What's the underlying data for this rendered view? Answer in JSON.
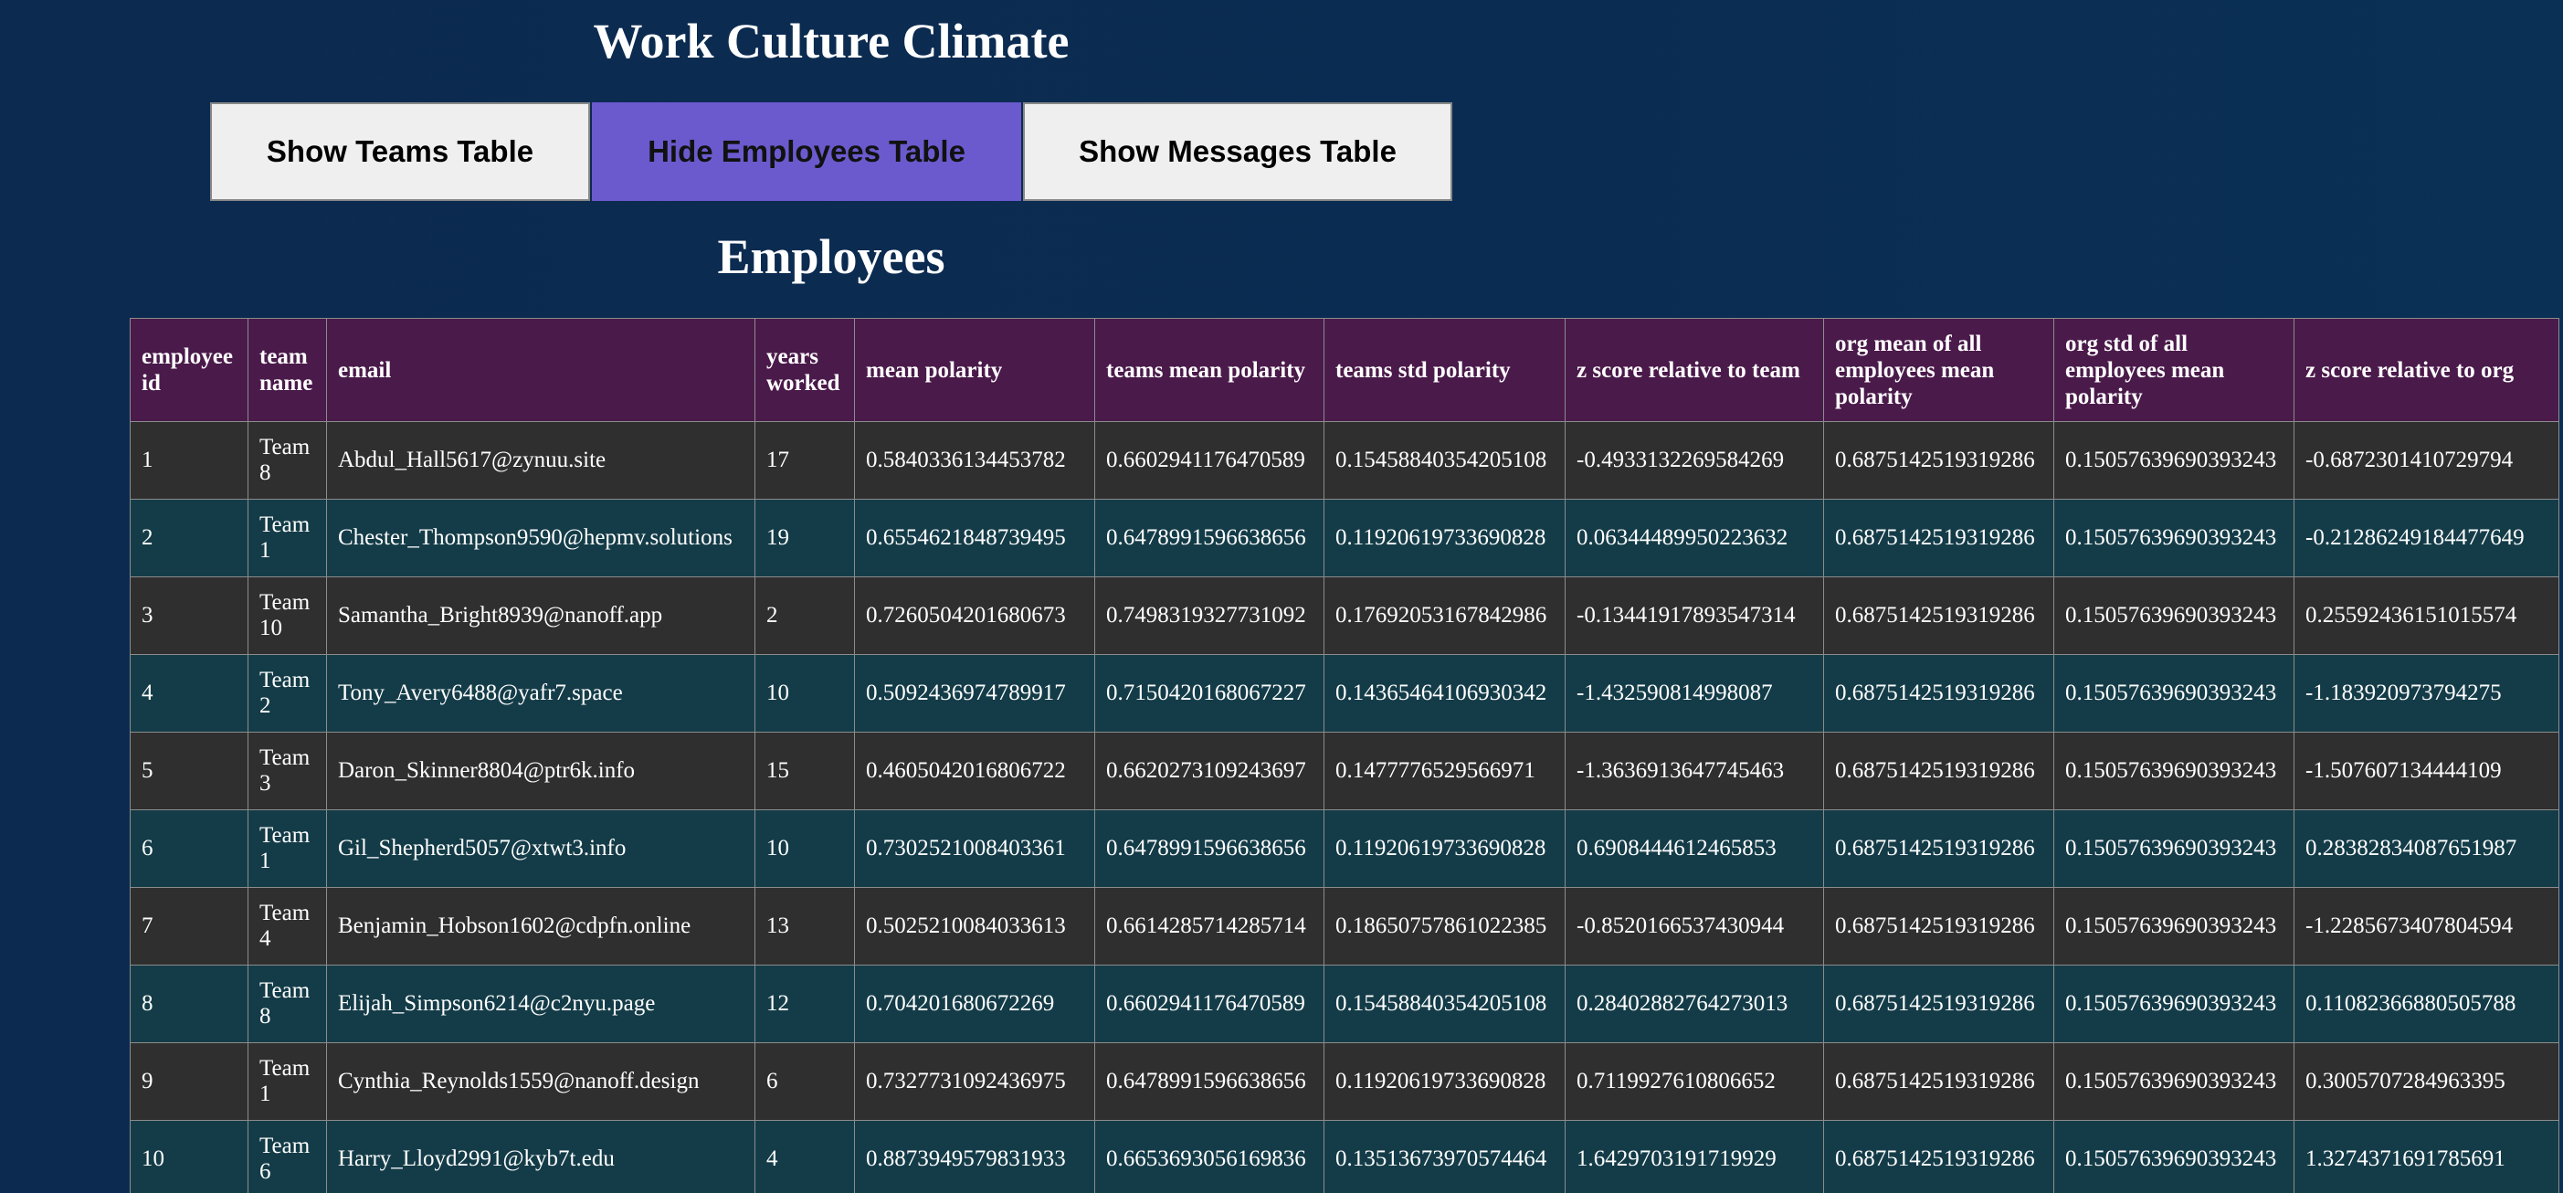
{
  "page_title": "Work Culture Climate",
  "buttons": {
    "teams": "Show Teams Table",
    "employees": "Hide Employees Table",
    "messages": "Show Messages Table"
  },
  "accent_color": "#6a5acd",
  "section_title": "Employees",
  "table": {
    "headers": [
      "employee id",
      "team name",
      "email",
      "years worked",
      "mean polarity",
      "teams mean polarity",
      "teams std polarity",
      "z score relative to team",
      "org mean of all employees mean polarity",
      "org std of all employees mean polarity",
      "z score relative to org"
    ],
    "rows": [
      [
        "1",
        "Team 8",
        "Abdul_Hall5617@zynuu.site",
        "17",
        "0.5840336134453782",
        "0.6602941176470589",
        "0.15458840354205108",
        "-0.4933132269584269",
        "0.6875142519319286",
        "0.15057639690393243",
        "-0.6872301410729794"
      ],
      [
        "2",
        "Team 1",
        "Chester_Thompson9590@hepmv.solutions",
        "19",
        "0.6554621848739495",
        "0.6478991596638656",
        "0.11920619733690828",
        "0.06344489950223632",
        "0.6875142519319286",
        "0.15057639690393243",
        "-0.21286249184477649"
      ],
      [
        "3",
        "Team 10",
        "Samantha_Bright8939@nanoff.app",
        "2",
        "0.7260504201680673",
        "0.7498319327731092",
        "0.17692053167842986",
        "-0.13441917893547314",
        "0.6875142519319286",
        "0.15057639690393243",
        "0.25592436151015574"
      ],
      [
        "4",
        "Team 2",
        "Tony_Avery6488@yafr7.space",
        "10",
        "0.5092436974789917",
        "0.7150420168067227",
        "0.14365464106930342",
        "-1.432590814998087",
        "0.6875142519319286",
        "0.15057639690393243",
        "-1.183920973794275"
      ],
      [
        "5",
        "Team 3",
        "Daron_Skinner8804@ptr6k.info",
        "15",
        "0.4605042016806722",
        "0.6620273109243697",
        "0.1477776529566971",
        "-1.3636913647745463",
        "0.6875142519319286",
        "0.15057639690393243",
        "-1.507607134444109"
      ],
      [
        "6",
        "Team 1",
        "Gil_Shepherd5057@xtwt3.info",
        "10",
        "0.7302521008403361",
        "0.6478991596638656",
        "0.11920619733690828",
        "0.6908444612465853",
        "0.6875142519319286",
        "0.15057639690393243",
        "0.28382834087651987"
      ],
      [
        "7",
        "Team 4",
        "Benjamin_Hobson1602@cdpfn.online",
        "13",
        "0.5025210084033613",
        "0.6614285714285714",
        "0.18650757861022385",
        "-0.8520166537430944",
        "0.6875142519319286",
        "0.15057639690393243",
        "-1.2285673407804594"
      ],
      [
        "8",
        "Team 8",
        "Elijah_Simpson6214@c2nyu.page",
        "12",
        "0.704201680672269",
        "0.6602941176470589",
        "0.15458840354205108",
        "0.28402882764273013",
        "0.6875142519319286",
        "0.15057639690393243",
        "0.11082366880505788"
      ],
      [
        "9",
        "Team 1",
        "Cynthia_Reynolds1559@nanoff.design",
        "6",
        "0.7327731092436975",
        "0.6478991596638656",
        "0.11920619733690828",
        "0.7119927610806652",
        "0.6875142519319286",
        "0.15057639690393243",
        "0.3005707284963395"
      ],
      [
        "10",
        "Team 6",
        "Harry_Lloyd2991@kyb7t.edu",
        "4",
        "0.8873949579831933",
        "0.6653693056169836",
        "0.13513673970574464",
        "1.6429703191719929",
        "0.6875142519319286",
        "0.15057639690393243",
        "1.3274371691785691"
      ]
    ]
  }
}
